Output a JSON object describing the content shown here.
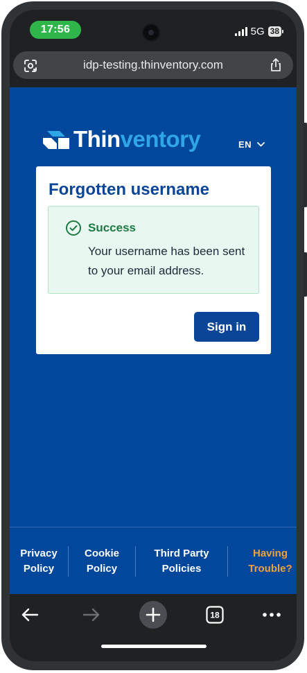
{
  "status_bar": {
    "time": "17:56",
    "network": "5G",
    "battery": "38"
  },
  "browser": {
    "url": "idp-testing.thinventory.com"
  },
  "site": {
    "brand_part1": "Thin",
    "brand_part2": "ventory",
    "language": "EN",
    "colors": {
      "brand_blue": "#01479b",
      "accent_cyan": "#2fa7e6",
      "success_green": "#1e7a45",
      "link_orange": "#f0a23a"
    }
  },
  "card": {
    "title": "Forgotten username",
    "alert": {
      "title": "Success",
      "message": "Your username has been sent to your email address."
    },
    "sign_in_label": "Sign in"
  },
  "footer": {
    "privacy": [
      "Privacy",
      "Policy"
    ],
    "cookie": [
      "Cookie",
      "Policy"
    ],
    "third_party": [
      "Third Party",
      "Policies"
    ],
    "trouble": [
      "Having",
      "Trouble?"
    ]
  },
  "browser_toolbar": {
    "tab_count": "18"
  },
  "icons": {
    "url_left": "lens-icon",
    "url_right": "share-icon",
    "alert": "check-circle-icon",
    "back": "arrow-left-icon",
    "forward": "arrow-right-icon",
    "new_tab": "plus-icon",
    "tabs": "tab-switcher-icon",
    "menu": "more-icon"
  }
}
